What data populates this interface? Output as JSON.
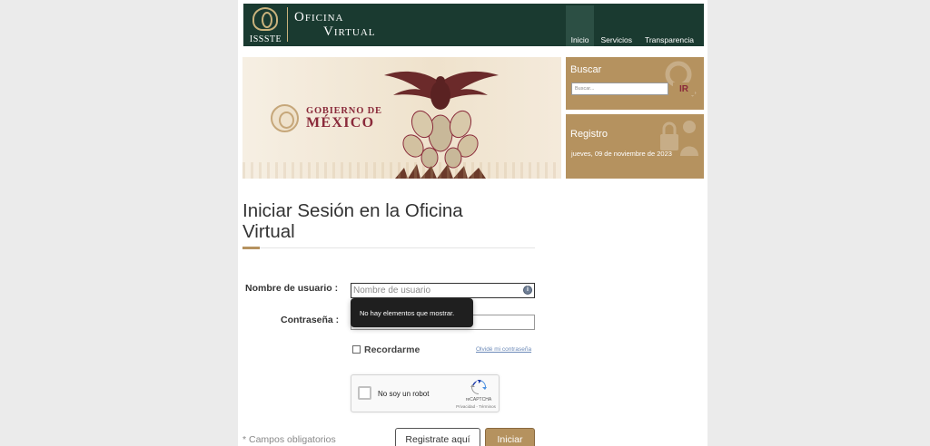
{
  "header": {
    "logo_text": "ISSSTE",
    "brand_line1": "Oficina",
    "brand_line2": "Virtual",
    "nav": [
      {
        "label": "Inicio",
        "active": true
      },
      {
        "label": "Servicios",
        "active": false
      },
      {
        "label": "Transparencia",
        "active": false
      }
    ]
  },
  "banner": {
    "line1": "GOBIERNO DE",
    "line2": "MÉXICO"
  },
  "search_card": {
    "title": "Buscar",
    "placeholder": "Buscar...",
    "button_label": "IR",
    "icon": "magnifier-icon"
  },
  "register_card": {
    "title": "Registro",
    "date": "jueves, 09 de noviembre de 2023",
    "icon": "user-lock-icon"
  },
  "login": {
    "title": "Iniciar Sesión en la Oficina Virtual",
    "username_label": "Nombre de usuario :",
    "username_placeholder": "Nombre de usuario",
    "password_label": "Contraseña :",
    "tooltip": "No hay elementos que mostrar.",
    "remember_label": "Recordarme",
    "forgot_link": "Olvidé mi contraseña",
    "required_note": "* Campos obligatorios",
    "register_button": "Registrate aquí",
    "login_button": "Iniciar"
  },
  "captcha": {
    "label": "No soy un robot",
    "brand": "reCAPTCHA",
    "terms": "Privacidad - Términos"
  },
  "colors": {
    "header_bg": "#1a3a30",
    "accent": "#b5925f",
    "brand_red": "#8a2a3a"
  }
}
